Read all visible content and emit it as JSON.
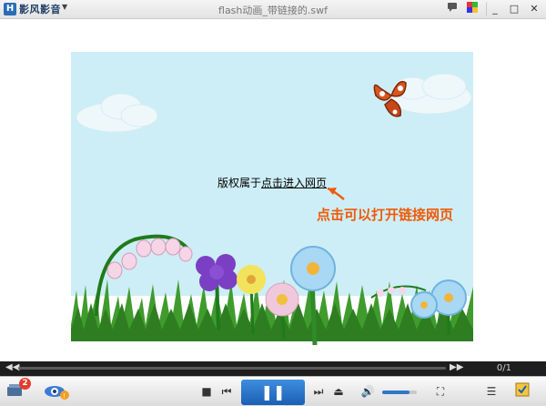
{
  "titlebar": {
    "app_name": "影风影音",
    "window_title": "flash动画_带链接的.swf",
    "menu_icon": "chevron-down-icon",
    "buttons": [
      "chat-icon",
      "color-picker-icon",
      "minimize-icon",
      "maximize-icon",
      "close-icon"
    ]
  },
  "content": {
    "copyright_prefix": "版权属于",
    "copyright_link": "点击进入网页",
    "callout": "点击可以打开链接网页",
    "callout_color": "#f05a0a",
    "sky_color": "#cdeef6"
  },
  "progress": {
    "frame_counter": "0/1"
  },
  "controls": {
    "notification_badge": "2",
    "volume_level": 0.8,
    "accent": "#2f77c9"
  }
}
